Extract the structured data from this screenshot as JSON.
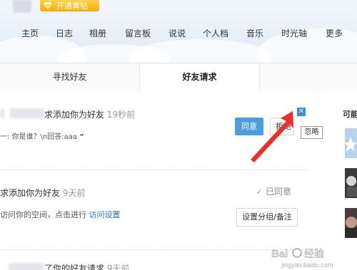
{
  "header": {
    "vip_label": "开通黄钻",
    "nav": [
      "主页",
      "日志",
      "相册",
      "留言板",
      "说说",
      "个人档",
      "音乐",
      "时光轴",
      "更多"
    ]
  },
  "tabs": {
    "find": "寻找好友",
    "requests": "好友请求"
  },
  "requests": [
    {
      "text": "求添加你为好友",
      "time": "19秒前",
      "message": "一: 你是谁？\\n回答:aaa",
      "agree_label": "同意",
      "refuse_label": "拒绝",
      "close_label": "✕",
      "tooltip": "忽略"
    },
    {
      "text": "求添加你为好友",
      "time": "9天前",
      "status": "已同意",
      "note_prefix": "访问你的空间，点击进行",
      "note_link": "访问设置",
      "group_button": "设置分组/备注"
    },
    {
      "text": "了你的好友请求",
      "time": "9天前"
    }
  ],
  "sidebar": {
    "title": "可能"
  },
  "watermark": {
    "text": "Bai 经验",
    "url": "jingyan.baidu.com"
  },
  "colors": {
    "accent": "#4b9fdc",
    "vip": "#f5a90b",
    "arrow": "#e8302a"
  }
}
